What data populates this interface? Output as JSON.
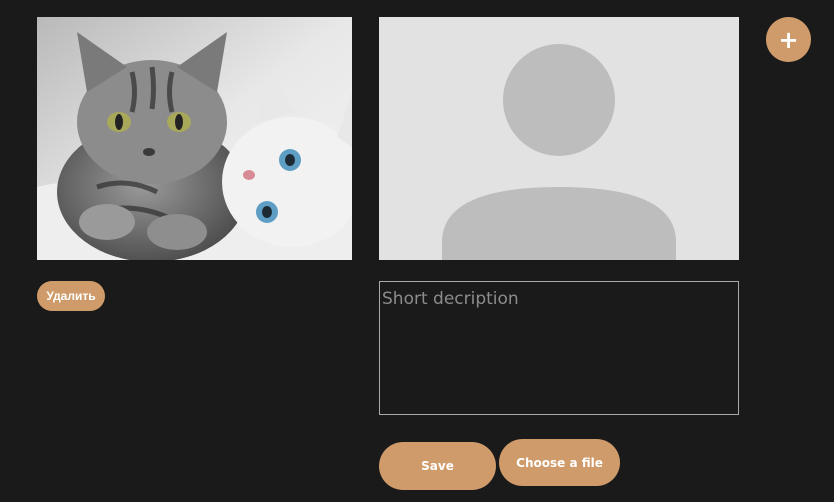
{
  "gallery": {
    "photo": {
      "subject": "two-kittens-photo"
    },
    "delete_label": "Удалить"
  },
  "form": {
    "avatar": {
      "icon": "user-placeholder-icon"
    },
    "description_placeholder": "Short decription",
    "description_value": "",
    "save_label": "Save",
    "choose_file_label": "Choose a file"
  },
  "toolbar": {
    "add_label": "+"
  },
  "colors": {
    "background": "#1a1a1a",
    "accent": "#d09b6a",
    "placeholder_bg": "#e2e2e2",
    "placeholder_shape": "#bdbdbd"
  }
}
